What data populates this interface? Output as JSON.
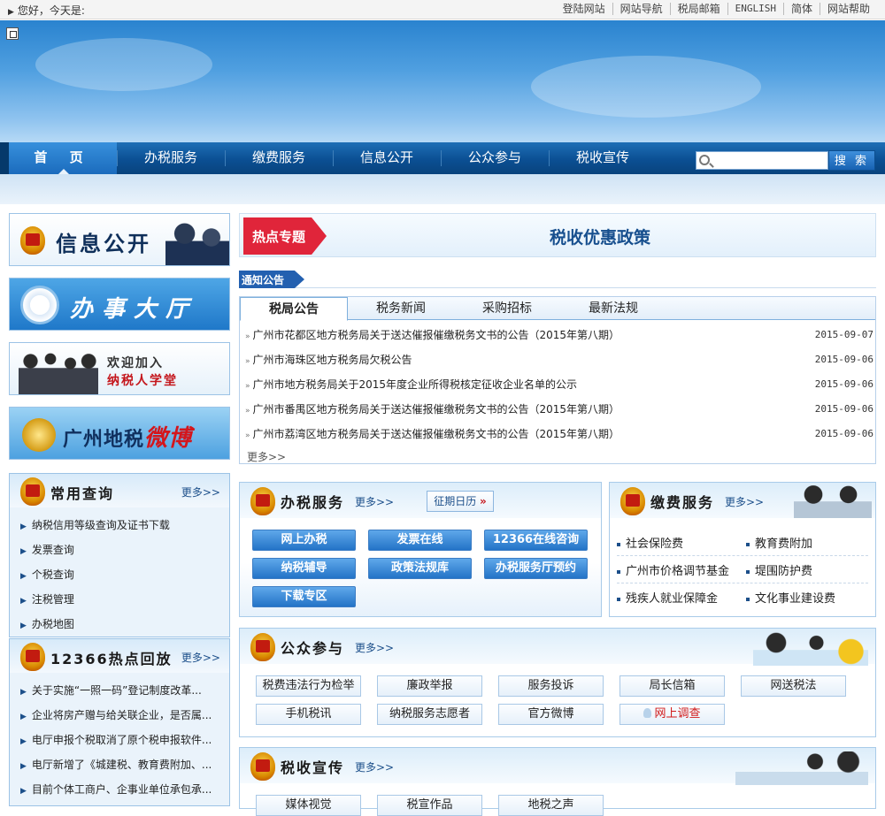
{
  "topbar": {
    "greeting": "您好，今天是:",
    "links": [
      "登陆网站",
      "网站导航",
      "税局邮箱",
      "ENGLISH",
      "简体",
      "网站帮助"
    ]
  },
  "nav": {
    "items": [
      "首 页",
      "办税服务",
      "缴费服务",
      "信息公开",
      "公众参与",
      "税收宣传"
    ],
    "active_index": 0,
    "search_placeholder": "",
    "search_button": "搜 索"
  },
  "left": {
    "banners": {
      "info": "信息公开",
      "hall": "办事大厅",
      "school_line1": "欢迎加入",
      "school_line2": "纳税人学堂",
      "weibo_main": "广州地税",
      "weibo_accent": "微博"
    },
    "common_query": {
      "title": "常用查询",
      "more": "更多>>",
      "items": [
        "纳税信用等级查询及证书下载",
        "发票查询",
        "个税查询",
        "注税管理",
        "办税地图"
      ]
    },
    "hotline": {
      "title": "12366热点回放",
      "more": "更多>>",
      "items": [
        "关于实施“一照一码”登记制度改革...",
        "企业将房产赠与给关联企业，是否属...",
        "电厅申报个税取消了原个税申报软件...",
        "电厅新增了《城建税、教育费附加、...",
        "目前个体工商户、企事业单位承包承..."
      ]
    }
  },
  "hot": {
    "tag": "热点专题",
    "title": "税收优惠政策"
  },
  "notice": {
    "tag": "通知公告",
    "tabs": [
      "税局公告",
      "税务新闻",
      "采购招标",
      "最新法规"
    ],
    "active_tab": 0,
    "items": [
      {
        "title": "广州市花都区地方税务局关于送达催报催缴税务文书的公告（2015年第八期）",
        "date": "2015-09-07"
      },
      {
        "title": "广州市海珠区地方税务局欠税公告",
        "date": "2015-09-06"
      },
      {
        "title": "广州市地方税务局关于2015年度企业所得税核定征收企业名单的公示",
        "date": "2015-09-06"
      },
      {
        "title": "广州市番禺区地方税务局关于送达催报催缴税务文书的公告（2015年第八期）",
        "date": "2015-09-06"
      },
      {
        "title": "广州市荔湾区地方税务局关于送达催报催缴税务文书的公告（2015年第八期）",
        "date": "2015-09-06"
      }
    ],
    "more": "更多>>"
  },
  "tax_service": {
    "title": "办税服务",
    "more": "更多>>",
    "calendar": "征期日历",
    "calendar_arrow": "»",
    "buttons": [
      "网上办税",
      "发票在线",
      "12366在线咨询",
      "纳税辅导",
      "政策法规库",
      "办税服务厅预约",
      "下载专区"
    ]
  },
  "fee_service": {
    "title": "缴费服务",
    "more": "更多>>",
    "items": [
      "社会保险费",
      "教育费附加",
      "广州市价格调节基金",
      "堤围防护费",
      "残疾人就业保障金",
      "文化事业建设费"
    ]
  },
  "public": {
    "title": "公众参与",
    "more": "更多>>",
    "buttons": [
      "税费违法行为检举",
      "廉政举报",
      "服务投诉",
      "局长信箱",
      "网送税法",
      "手机税讯",
      "纳税服务志愿者",
      "官方微博",
      "网上调查"
    ]
  },
  "promo": {
    "title": "税收宣传",
    "more": "更多>>",
    "buttons": [
      "媒体视觉",
      "税宣作品",
      "地税之声"
    ]
  },
  "colors": {
    "nav": "#0b4f93",
    "accent_red": "#e0253a",
    "link_blue": "#1c4f8a"
  }
}
